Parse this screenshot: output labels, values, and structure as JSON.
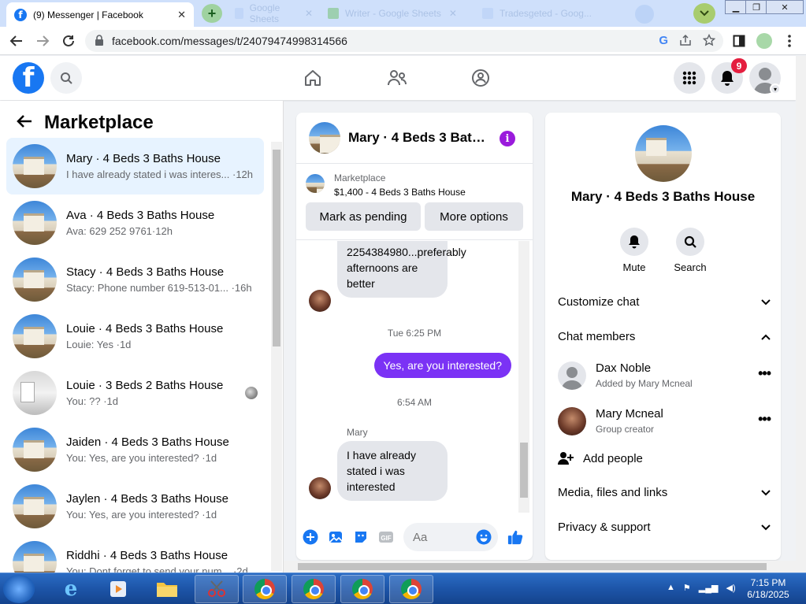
{
  "browser": {
    "active_tab_title": "(9) Messenger | Facebook",
    "other_tabs": [
      "Google Sheets",
      "Writer - Google Sheets",
      "Tradesgeted - Goog..."
    ],
    "url": "facebook.com/messages/t/24079474998314566"
  },
  "fb_header": {
    "notification_count": "9"
  },
  "left_panel": {
    "title": "Marketplace",
    "conversations": [
      {
        "name": "Mary · 4 Beds 3 Baths House",
        "preview": "I have already stated i was interes... ·12h",
        "thumb": "house",
        "active": true
      },
      {
        "name": "Ava · 4 Beds 3 Baths House",
        "preview": "Ava: 629 252 9761·12h",
        "thumb": "house"
      },
      {
        "name": "Stacy · 4 Beds 3 Baths House",
        "preview": "Stacy: Phone number 619-513-01... ·16h",
        "thumb": "house"
      },
      {
        "name": "Louie · 4 Beds 3 Baths House",
        "preview": "Louie: Yes ·1d",
        "thumb": "house"
      },
      {
        "name": "Louie · 3 Beds 2 Baths House",
        "preview": "You: ?? ·1d",
        "thumb": "room"
      },
      {
        "name": "Jaiden · 4 Beds 3 Baths House",
        "preview": "You: Yes, are you interested? ·1d",
        "thumb": "house"
      },
      {
        "name": "Jaylen · 4 Beds 3 Baths House",
        "preview": "You: Yes, are you interested? ·1d",
        "thumb": "house"
      },
      {
        "name": "Riddhi · 4 Beds 3 Baths House",
        "preview": "You: Dont forget to send your num... ·2d",
        "thumb": "house"
      }
    ]
  },
  "chat": {
    "title": "Mary · 4 Beds 3 Baths House",
    "marketplace_label": "Marketplace",
    "listing": "$1,400 - 4 Beds 3 Baths House",
    "mark_pending": "Mark as pending",
    "more_options": "More options",
    "msg1": "2254384980...preferably afternoons are better",
    "time1": "Tue 6:25 PM",
    "msg2": "Yes, are you interested?",
    "time2": "6:54 AM",
    "sender": "Mary",
    "msg3": "I have already stated i was interested",
    "input_placeholder": "Aa"
  },
  "right_panel": {
    "title": "Mary · 4 Beds 3 Baths House",
    "mute": "Mute",
    "search": "Search",
    "customize": "Customize chat",
    "chat_members": "Chat members",
    "members": [
      {
        "name": "Dax Noble",
        "sub": "Added by Mary Mcneal"
      },
      {
        "name": "Mary Mcneal",
        "sub": "Group creator"
      }
    ],
    "add_people": "Add people",
    "media": "Media, files and links",
    "privacy": "Privacy & support"
  },
  "taskbar": {
    "time": "7:15 PM",
    "date": "6/18/2025"
  },
  "colors": {
    "fb_blue": "#1877f2",
    "outgoing_bubble": "#7b32f5",
    "active_conv": "#e7f3ff"
  }
}
